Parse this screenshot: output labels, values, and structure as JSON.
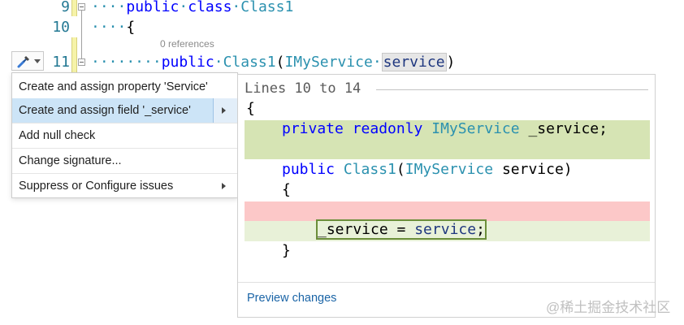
{
  "editor": {
    "lines": [
      {
        "num": "9",
        "indent": "····",
        "tokens": [
          [
            "kw",
            "public"
          ],
          [
            "ws",
            "·"
          ],
          [
            "kw",
            "class"
          ],
          [
            "ws",
            "·"
          ],
          [
            "ty",
            "Class1"
          ]
        ]
      },
      {
        "num": "10",
        "indent": "····",
        "tokens": [
          [
            "tx",
            "{"
          ]
        ]
      },
      {
        "num": "11",
        "indent": "········",
        "tokens": [
          [
            "kw",
            "public"
          ],
          [
            "ws",
            "·"
          ],
          [
            "ty",
            "Class1"
          ],
          [
            "tx",
            "("
          ],
          [
            "ty",
            "IMyService"
          ],
          [
            "ws",
            "·"
          ]
        ]
      }
    ],
    "param_name": "service",
    "close_paren": ")",
    "references_label": "0 references"
  },
  "lightbulb": {
    "icon": "screwdriver-icon"
  },
  "menu": {
    "items": [
      {
        "label": "Create and assign property 'Service'",
        "selected": false,
        "submenu": false
      },
      {
        "label": "Create and assign field '_service'",
        "selected": true,
        "submenu": true
      },
      {
        "label": "Add null check",
        "selected": false,
        "submenu": false
      },
      {
        "label": "Change signature...",
        "selected": false,
        "submenu": false
      },
      {
        "label": "Suppress or Configure issues",
        "selected": false,
        "submenu": true
      }
    ]
  },
  "preview": {
    "title": "Lines 10 to 14",
    "lines": {
      "open_brace": "{",
      "field_kw": "private readonly ",
      "field_type": "IMyService",
      "field_rest": " _service;",
      "ctor_kw": "public ",
      "ctor_name": "Class1",
      "ctor_open": "(",
      "ctor_type": "IMyService",
      "ctor_param": " service)",
      "inner_open": "{",
      "assign_lhs": "_service",
      "assign_mid": " = ",
      "assign_rhs": "service",
      "assign_end": ";",
      "inner_close": "}"
    },
    "footer_link": "Preview changes",
    "colors": {
      "added": "#d6e4b4",
      "removed": "#fcc8c8",
      "changed": "#e8f1d8",
      "box": "#6b8e3a"
    }
  },
  "watermark": "@稀土掘金技术社区"
}
